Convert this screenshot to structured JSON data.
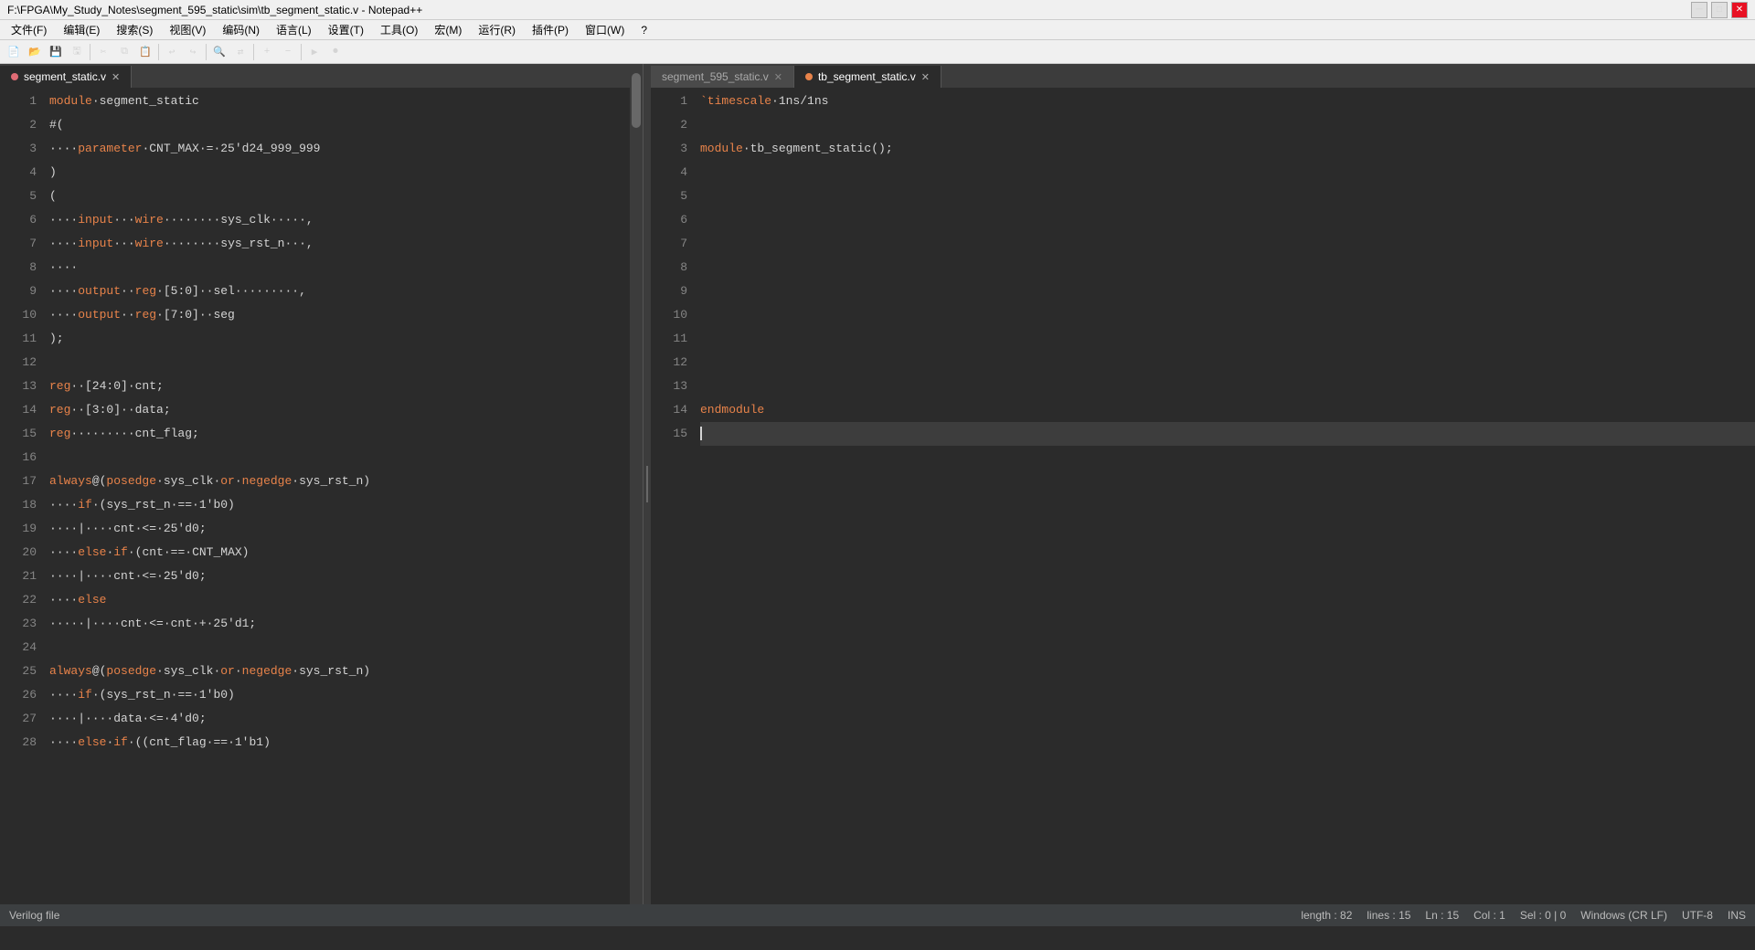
{
  "titlebar": {
    "title": "F:\\FPGA\\My_Study_Notes\\segment_595_static\\sim\\tb_segment_static.v - Notepad++",
    "minimize": "─",
    "maximize": "□",
    "close": "✕"
  },
  "menubar": {
    "items": [
      "文件(F)",
      "编辑(E)",
      "搜索(S)",
      "视图(V)",
      "编码(N)",
      "语言(L)",
      "设置(T)",
      "工具(O)",
      "宏(M)",
      "运行(R)",
      "插件(P)",
      "窗口(W)",
      "?"
    ]
  },
  "status": {
    "file_type": "Verilog file",
    "length": "length : 82",
    "lines": "lines : 15",
    "ln": "Ln : 15",
    "col": "Col : 1",
    "sel": "Sel : 0 | 0",
    "encoding": "Windows (CR LF)",
    "charset": "UTF-8",
    "ins": "INS"
  },
  "left_tab": {
    "label": "segment_static.v",
    "indicator": "red"
  },
  "right_tabs": [
    {
      "label": "segment_595_static.v",
      "indicator": "none",
      "active": false
    },
    {
      "label": "tb_segment_static.v",
      "indicator": "orange",
      "active": true
    }
  ],
  "left_code": {
    "lines": [
      {
        "num": 1,
        "content": "module·segment_static"
      },
      {
        "num": 2,
        "content": "#("
      },
      {
        "num": 3,
        "content": "····parameter·CNT_MAX·=·25'd24_999_999"
      },
      {
        "num": 4,
        "content": ")"
      },
      {
        "num": 5,
        "content": "("
      },
      {
        "num": 6,
        "content": "····input···wire········sys_clk·····,"
      },
      {
        "num": 7,
        "content": "····input···wire········sys_rst_n···,"
      },
      {
        "num": 8,
        "content": "····"
      },
      {
        "num": 9,
        "content": "····output··reg·[5:0]··sel·········,"
      },
      {
        "num": 10,
        "content": "····output··reg·[7:0]··seg"
      },
      {
        "num": 11,
        "content": ");"
      },
      {
        "num": 12,
        "content": ""
      },
      {
        "num": 13,
        "content": "reg··[24:0]·cnt;"
      },
      {
        "num": 14,
        "content": "reg··[3:0]··data;"
      },
      {
        "num": 15,
        "content": "reg·········cnt_flag;"
      },
      {
        "num": 16,
        "content": ""
      },
      {
        "num": 17,
        "content": "always@(posedge·sys_clk·or·negedge·sys_rst_n)"
      },
      {
        "num": 18,
        "content": "····if·(sys_rst_n·==·1'b0)"
      },
      {
        "num": 19,
        "content": "····|····cnt·<=·25'd0;"
      },
      {
        "num": 20,
        "content": "····else·if·(cnt·==·CNT_MAX)"
      },
      {
        "num": 21,
        "content": "····|····cnt·<=·25'd0;"
      },
      {
        "num": 22,
        "content": "····else"
      },
      {
        "num": 23,
        "content": "·····|····cnt·<=·cnt·+·25'd1;"
      },
      {
        "num": 24,
        "content": ""
      },
      {
        "num": 25,
        "content": "always@(posedge·sys_clk·or·negedge·sys_rst_n)"
      },
      {
        "num": 26,
        "content": "····if·(sys_rst_n·==·1'b0)"
      },
      {
        "num": 27,
        "content": "····|····data·<=·4'd0;"
      },
      {
        "num": 28,
        "content": "····else·if·((cnt_flag·==·1'b1)"
      }
    ]
  },
  "right_code": {
    "lines": [
      {
        "num": 1,
        "content": "`timescale·1ns/1ns"
      },
      {
        "num": 2,
        "content": ""
      },
      {
        "num": 3,
        "content": "module·tb_segment_static();"
      },
      {
        "num": 4,
        "content": ""
      },
      {
        "num": 5,
        "content": ""
      },
      {
        "num": 6,
        "content": ""
      },
      {
        "num": 7,
        "content": ""
      },
      {
        "num": 8,
        "content": ""
      },
      {
        "num": 9,
        "content": ""
      },
      {
        "num": 10,
        "content": ""
      },
      {
        "num": 11,
        "content": ""
      },
      {
        "num": 12,
        "content": ""
      },
      {
        "num": 13,
        "content": ""
      },
      {
        "num": 14,
        "content": "endmodule"
      },
      {
        "num": 15,
        "content": ""
      }
    ]
  }
}
